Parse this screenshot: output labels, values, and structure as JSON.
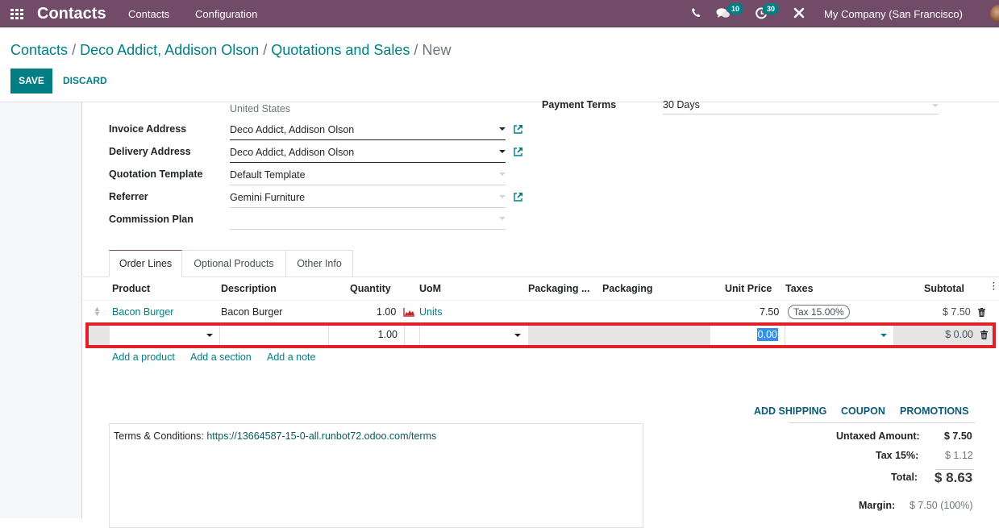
{
  "navbar": {
    "app_name": "Contacts",
    "menus": [
      "Contacts",
      "Configuration"
    ],
    "icons": [
      "phone-icon",
      "chat-icon",
      "activity-clock-icon",
      "tools-icon"
    ],
    "messages_count": "10",
    "activities_count": "30",
    "company": "My Company (San Francisco)"
  },
  "breadcrumb": {
    "items": [
      "Contacts",
      "Deco Addict, Addison Olson",
      "Quotations and Sales"
    ],
    "current": "New",
    "separator": "/"
  },
  "toolbar": {
    "save_label": "SAVE",
    "discard_label": "DISCARD"
  },
  "form": {
    "country": "United States",
    "fields": [
      {
        "label": "Invoice Address",
        "value": "Deco Addict, Addison Olson"
      },
      {
        "label": "Delivery Address",
        "value": "Deco Addict, Addison Olson"
      },
      {
        "label": "Quotation Template",
        "value": "Default Template"
      },
      {
        "label": "Referrer",
        "value": "Gemini Furniture"
      },
      {
        "label": "Commission Plan",
        "value": ""
      }
    ],
    "payment_terms_label": "Payment Terms",
    "payment_terms_value": "30 Days"
  },
  "tabs": [
    "Order Lines",
    "Optional Products",
    "Other Info"
  ],
  "order_lines": {
    "columns": [
      "Product",
      "Description",
      "Quantity",
      "UoM",
      "Packaging ...",
      "Packaging",
      "Unit Price",
      "Taxes",
      "Subtotal"
    ],
    "rows": [
      {
        "product": "Bacon Burger",
        "description": "Bacon Burger",
        "quantity": "1.00",
        "uom": "Units",
        "unit_price": "7.50",
        "taxes": "Tax 15.00%",
        "subtotal": "$ 7.50"
      }
    ],
    "editing_row": {
      "product": "",
      "description": "",
      "quantity": "1.00",
      "uom": "",
      "unit_price": "0.00",
      "taxes": "",
      "subtotal": "$ 0.00"
    },
    "add_links": [
      "Add a product",
      "Add a section",
      "Add a note"
    ]
  },
  "footer": {
    "terms_label": "Terms & Conditions:",
    "terms_url": "https://13664587-15-0-all.runbot72.odoo.com/terms",
    "actions": [
      "ADD SHIPPING",
      "COUPON",
      "PROMOTIONS"
    ],
    "untaxed_label": "Untaxed Amount:",
    "untaxed_value": "$ 7.50",
    "tax_label": "Tax 15%:",
    "tax_value": "$ 1.12",
    "total_label": "Total:",
    "total_value": "$ 8.63",
    "margin_label": "Margin:",
    "margin_value": "$ 7.50 (100%)"
  },
  "colors": {
    "brand": "#714b67",
    "accent": "#017e84",
    "highlight_border": "#e02127"
  }
}
